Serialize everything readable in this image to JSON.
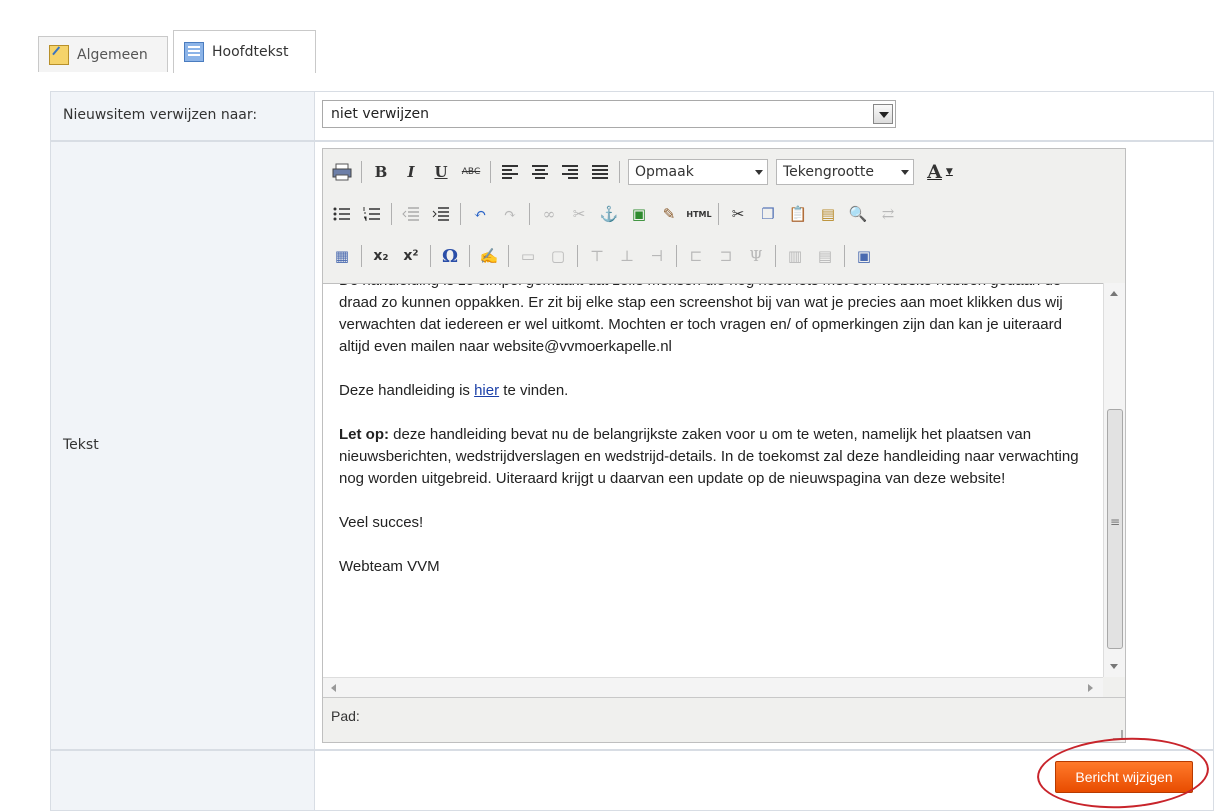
{
  "tabs": [
    {
      "label": "Algemeen",
      "icon": "edit-page-icon",
      "active": false
    },
    {
      "label": "Hoofdtekst",
      "icon": "text-page-icon",
      "active": true
    }
  ],
  "form": {
    "redirect_label": "Nieuwsitem verwijzen naar:",
    "redirect_value": "niet verwijzen",
    "text_label": "Tekst"
  },
  "editor": {
    "toolbar": {
      "format_dropdown": "Opmaak",
      "fontsize_dropdown": "Tekengrootte",
      "bold": "B",
      "italic": "I",
      "underline": "U",
      "strike": "ABC",
      "html": "HTML",
      "subscript": "x₂",
      "superscript": "x²",
      "omega": "Ω",
      "font_color": "A"
    },
    "content": {
      "p1": "De handleiding is zo simpel gemaakt dat zelfs mensen die nog nooit iets met een website hebben gedaan de draad zo kunnen oppakken. Er zit bij elke stap een screenshot bij van wat je precies aan moet klikken dus wij verwachten dat iedereen er wel uitkomt. Mochten er toch vragen en/ of opmerkingen zijn dan kan je uiteraard altijd even mailen naar website@vvmoerkapelle.nl",
      "p2_before": "Deze handleiding is ",
      "p2_link": "hier",
      "p2_after": " te vinden.",
      "p3_bold": "Let op:",
      "p3_rest": " deze handleiding bevat nu de belangrijkste zaken voor u om te weten, namelijk het plaatsen van nieuwsberichten, wedstrijdverslagen en wedstrijd-details. In de toekomst zal deze handleiding naar verwachting nog worden uitgebreid. Uiteraard krijgt u daarvan een update op de nieuwspagina van deze website!",
      "p4": "Veel succes!",
      "p5": "Webteam VVM"
    },
    "path_label": "Pad:"
  },
  "submit_label": "Bericht wijzigen",
  "colors": {
    "submit_bg": "#f05a0a",
    "annotation_circle": "#c8242b",
    "label_bg": "#f1f4f8"
  }
}
